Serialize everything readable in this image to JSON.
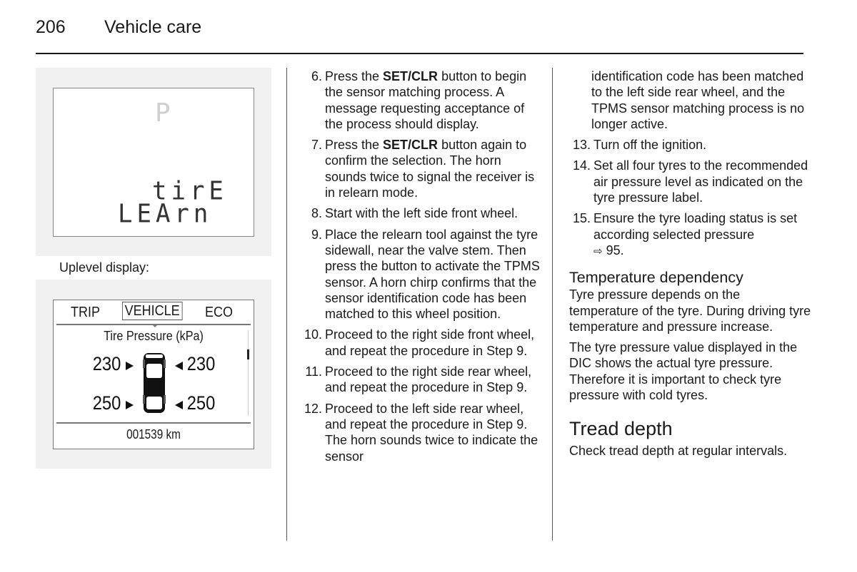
{
  "header": {
    "page_number": "206",
    "section": "Vehicle care"
  },
  "figure_basic": {
    "gear_indicator": "P",
    "line1": "tirE",
    "line2": "LEArn"
  },
  "caption_uplevel": "Uplevel display:",
  "figure_uplevel": {
    "tabs": [
      "TRIP",
      "VEHICLE",
      "ECO"
    ],
    "selected_tab": "VEHICLE",
    "subtitle": "Tire Pressure (kPa)",
    "pressures": {
      "front_left": "230",
      "front_right": "230",
      "rear_left": "250",
      "rear_right": "250"
    },
    "odometer": "001539 km"
  },
  "steps_col2": [
    {
      "num": "6.",
      "pre": "Press the ",
      "bold": "SET/CLR",
      "post": " button to begin the sensor matching process. A message requesting acceptance of the process should display."
    },
    {
      "num": "7.",
      "pre": "Press the ",
      "bold": "SET/CLR",
      "post": " button again to confirm the selection. The horn sounds twice to signal the receiver is in relearn mode."
    },
    {
      "num": "8.",
      "text": "Start with the left side front wheel."
    },
    {
      "num": "9.",
      "text": "Place the relearn tool against the tyre sidewall, near the valve stem. Then press the button to activate the TPMS sensor. A horn chirp confirms that the sensor identification code has been matched to this wheel position."
    },
    {
      "num": "10.",
      "text": "Proceed to the right side front wheel, and repeat the procedure in Step 9."
    },
    {
      "num": "11.",
      "text": "Proceed to the right side rear wheel, and repeat the procedure in Step 9."
    },
    {
      "num": "12.",
      "text": "Proceed to the left side rear wheel, and repeat the procedure in Step 9. The horn sounds twice to indicate the sensor"
    }
  ],
  "col3": {
    "continuation": "identification code has been matched to the left side rear wheel, and the TPMS sensor matching process is no longer active.",
    "steps": [
      {
        "num": "13.",
        "text": "Turn off the ignition."
      },
      {
        "num": "14.",
        "text": "Set all four tyres to the recommended air pressure level as indicated on the tyre pressure label."
      },
      {
        "num": "15.",
        "text": "Ensure the tyre loading status is set according selected pressure",
        "ref_icon": "⇨",
        "ref_page": "95."
      }
    ],
    "temperature_heading": "Temperature dependency",
    "temperature_p1": "Tyre pressure depends on the temperature of the tyre. During driving tyre temperature and pressure increase.",
    "temperature_p2": "The tyre pressure value displayed in the DIC shows the actual tyre pressure. Therefore it is important to check tyre pressure with cold tyres.",
    "tread_heading": "Tread depth",
    "tread_p1": "Check tread depth at regular intervals."
  }
}
